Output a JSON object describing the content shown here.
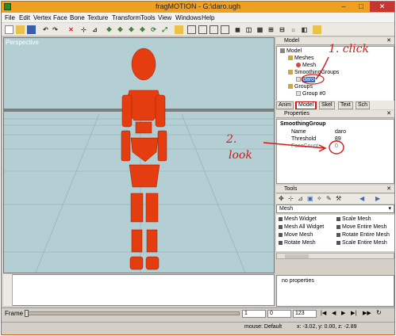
{
  "window": {
    "title": "fragMOTION - G:\\daro.ugh",
    "min": "–",
    "max": "□",
    "close": "✕"
  },
  "menu": [
    "File",
    "Edit",
    "Vertex",
    "Face",
    "Bone",
    "Texture",
    "Transform",
    "Tools",
    "View",
    "Windows",
    "Help"
  ],
  "viewport": {
    "label": "Perspective"
  },
  "model_panel": {
    "title": "Model",
    "tree": [
      {
        "label": "Model",
        "color": "#888888"
      },
      {
        "label": "Meshes",
        "color": "#c9a64b"
      },
      {
        "label": "Mesh",
        "color": "#d64545"
      },
      {
        "label": "SmoothingGroups",
        "color": "#c9a64b"
      },
      {
        "label": "daro",
        "color": "#e0e0e0"
      },
      {
        "label": "Groups",
        "color": "#c9a64b"
      },
      {
        "label": "Group #0",
        "color": "#e0e0e0"
      }
    ],
    "tabs": [
      "Anim",
      "Model",
      "Skel",
      "Text",
      "Sch"
    ]
  },
  "properties": {
    "title": "Properties",
    "group": "SmoothingGroup",
    "rows": [
      {
        "name": "Name",
        "value": "daro"
      },
      {
        "name": "Threshold",
        "value": "89"
      },
      {
        "name": "FaceCount",
        "value": "0"
      }
    ]
  },
  "tools": {
    "title": "Tools",
    "selected": "Mesh",
    "items": [
      "Mesh Widget",
      "Scale Mesh",
      "Mesh All Widget",
      "Move Entire Mesh",
      "Move Mesh",
      "Rotate Entire Mesh",
      "Rotate Mesh",
      "Scale Entire Mesh"
    ],
    "no_properties": "no properties"
  },
  "timeline": {
    "label": "Frame",
    "start": "1",
    "current": "0",
    "end": "123"
  },
  "status": {
    "mode": "mouse: Default",
    "coords": "x: -3.02, y: 0.00, z: -2.89"
  },
  "annotations": {
    "step1": "1. click",
    "step2": "2.",
    "look": "look"
  },
  "colors": {
    "titlebar": "#f0a020",
    "model": "#e33d10",
    "annotation": "#d11a1a"
  }
}
